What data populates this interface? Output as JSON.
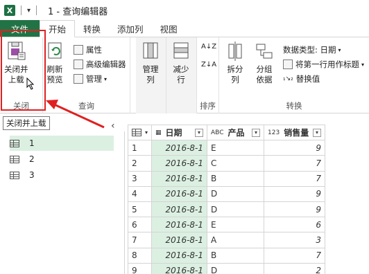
{
  "titlebar": {
    "app_icon": "X",
    "quick_access": "▾",
    "title": "1 - 查询编辑器"
  },
  "tabs": [
    {
      "label": "文件"
    },
    {
      "label": "开始"
    },
    {
      "label": "转换"
    },
    {
      "label": "添加列"
    },
    {
      "label": "视图"
    }
  ],
  "ribbon": {
    "close": {
      "label1": "关闭并",
      "label2": "上载",
      "group": "关闭"
    },
    "query": {
      "refresh1": "刷新",
      "refresh2": "预览",
      "properties": "属性",
      "advanced": "高级编辑器",
      "manage": "管理",
      "group": "查询"
    },
    "columns": {
      "manage1": "管理",
      "manage2": "列"
    },
    "rows": {
      "reduce1": "减少",
      "reduce2": "行"
    },
    "sort": {
      "group": "排序"
    },
    "transform": {
      "split1": "拆分",
      "split2": "列",
      "groupby1": "分组",
      "groupby2": "依据",
      "datatype": "数据类型: 日期",
      "firstrow": "将第一行用作标题",
      "replace": "替换值",
      "group": "转换"
    }
  },
  "tooltip": "关闭并上载",
  "queries": [
    {
      "label": "1"
    },
    {
      "label": "2"
    },
    {
      "label": "3"
    }
  ],
  "table": {
    "columns": [
      {
        "type": "",
        "label": ""
      },
      {
        "type": "▦",
        "label": "日期"
      },
      {
        "type": "ABC",
        "label": "产品"
      },
      {
        "type": "123",
        "label": "销售量"
      }
    ],
    "rows": [
      {
        "n": "1",
        "date": "2016-8-1",
        "product": "E",
        "qty": "9"
      },
      {
        "n": "2",
        "date": "2016-8-1",
        "product": "C",
        "qty": "7"
      },
      {
        "n": "3",
        "date": "2016-8-1",
        "product": "B",
        "qty": "7"
      },
      {
        "n": "4",
        "date": "2016-8-1",
        "product": "D",
        "qty": "9"
      },
      {
        "n": "5",
        "date": "2016-8-1",
        "product": "D",
        "qty": "9"
      },
      {
        "n": "6",
        "date": "2016-8-1",
        "product": "E",
        "qty": "6"
      },
      {
        "n": "7",
        "date": "2016-8-1",
        "product": "A",
        "qty": "3"
      },
      {
        "n": "8",
        "date": "2016-8-1",
        "product": "B",
        "qty": "7"
      },
      {
        "n": "9",
        "date": "2016-8-1",
        "product": "D",
        "qty": "2"
      }
    ]
  },
  "colors": {
    "accent": "#217346",
    "highlight": "#e02020",
    "selected": "#dcf0e2"
  }
}
